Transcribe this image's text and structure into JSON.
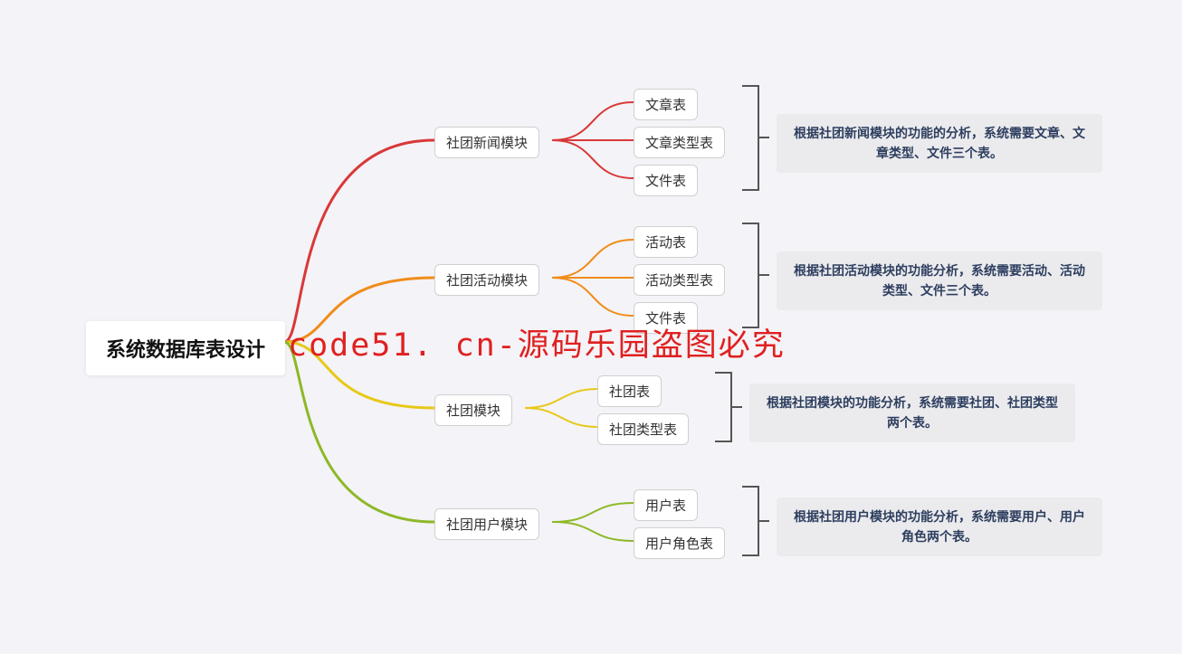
{
  "root": "系统数据库表设计",
  "watermark": "code51. cn-源码乐园盗图必究",
  "branches": [
    {
      "label": "社团新闻模块",
      "color": "#d93838",
      "children": [
        "文章表",
        "文章类型表",
        "文件表"
      ],
      "annotation": "根据社团新闻模块的功能的分析，系统需要文章、文章类型、文件三个表。"
    },
    {
      "label": "社团活动模块",
      "color": "#f08c1a",
      "children": [
        "活动表",
        "活动类型表",
        "文件表"
      ],
      "annotation": "根据社团活动模块的功能分析，系统需要活动、活动类型、文件三个表。"
    },
    {
      "label": "社团模块",
      "color": "#e8c818",
      "children": [
        "社团表",
        "社团类型表"
      ],
      "annotation": "根据社团模块的功能分析，系统需要社团、社团类型两个表。"
    },
    {
      "label": "社团用户模块",
      "color": "#8db828",
      "children": [
        "用户表",
        "用户角色表"
      ],
      "annotation": "根据社团用户模块的功能分析，系统需要用户、用户角色两个表。"
    }
  ]
}
